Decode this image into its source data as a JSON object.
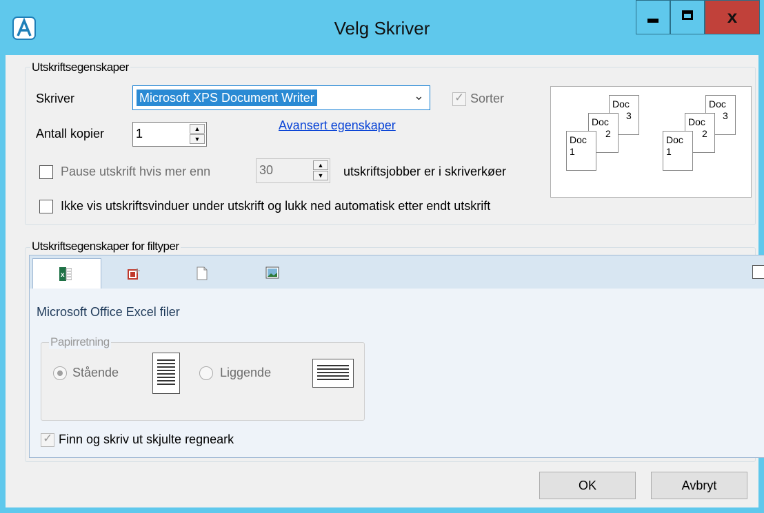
{
  "window": {
    "title": "Velg Skriver"
  },
  "print_props": {
    "legend": "Utskriftsegenskaper",
    "printer_label": "Skriver",
    "printer_value": "Microsoft XPS Document Writer",
    "sort_label": "Sorter",
    "copies_label": "Antall kopier",
    "copies_value": "1",
    "advanced_link": "Avansert egenskaper",
    "pause_label": "Pause utskrift hvis mer enn",
    "pause_value": "30",
    "pause_suffix": "utskriftsjobber er i skriverkøer",
    "hide_windows_label": "Ikke vis utskriftsvinduer under utskrift og lukk ned automatisk etter endt utskrift"
  },
  "collate_preview": {
    "doc_label": "Doc",
    "numbers": [
      "1",
      "2",
      "3"
    ]
  },
  "filetypes": {
    "legend": "Utskriftsegenskaper for filtyper",
    "tabs": [
      "excel-icon",
      "powerpoint-icon",
      "document-icon",
      "image-icon"
    ],
    "panel_title": "Microsoft Office Excel filer",
    "orientation_legend": "Papirretning",
    "portrait_label": "Stående",
    "landscape_label": "Liggende",
    "hidden_sheets_label": "Finn og skriv ut skjulte regneark"
  },
  "buttons": {
    "ok": "OK",
    "cancel": "Avbryt"
  },
  "colors": {
    "titlebar": "#5fc8ec",
    "close": "#c1413a",
    "selection": "#2a8ad4",
    "link": "#0a44d6"
  }
}
